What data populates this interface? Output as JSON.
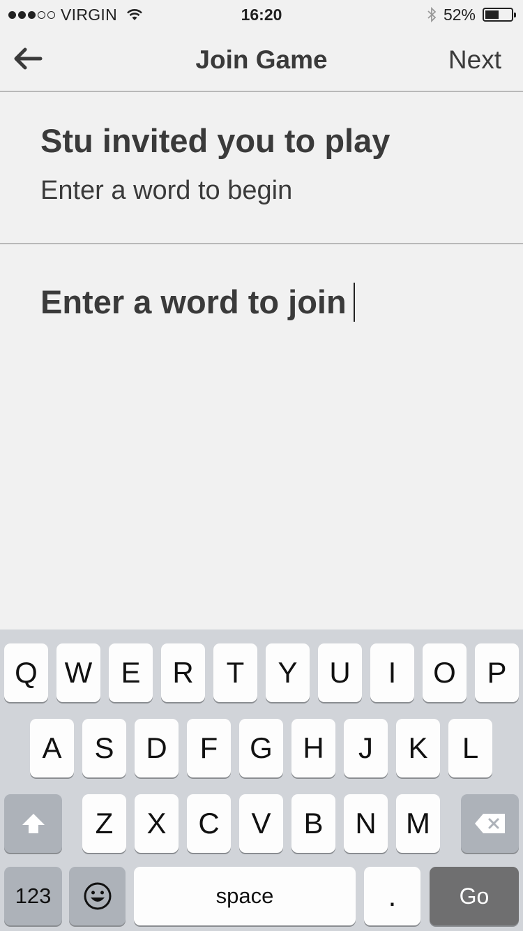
{
  "status_bar": {
    "carrier": "VIRGIN",
    "signal_bars_filled": 3,
    "signal_bars_total": 5,
    "time": "16:20",
    "battery_percent": "52%",
    "battery_level": 0.52
  },
  "nav": {
    "title": "Join Game",
    "next_label": "Next",
    "back_icon": "arrow-left-icon"
  },
  "invite": {
    "title": "Stu invited you to play",
    "subtitle": "Enter a word to begin"
  },
  "word_input": {
    "placeholder": "Enter a word to join"
  },
  "keyboard": {
    "row1": [
      "Q",
      "W",
      "E",
      "R",
      "T",
      "Y",
      "U",
      "I",
      "O",
      "P"
    ],
    "row2": [
      "A",
      "S",
      "D",
      "F",
      "G",
      "H",
      "J",
      "K",
      "L"
    ],
    "row3": [
      "Z",
      "X",
      "C",
      "V",
      "B",
      "N",
      "M"
    ],
    "numbers_label": "123",
    "space_label": "space",
    "period_label": ".",
    "go_label": "Go",
    "shift_icon": "shift-icon",
    "delete_icon": "backspace-icon",
    "emoji_icon": "emoji-icon"
  },
  "colors": {
    "background": "#f1f1f1",
    "text": "#3a3a3a",
    "keyboard_bg": "#d1d4d9",
    "go_key": "#6f6f70"
  }
}
